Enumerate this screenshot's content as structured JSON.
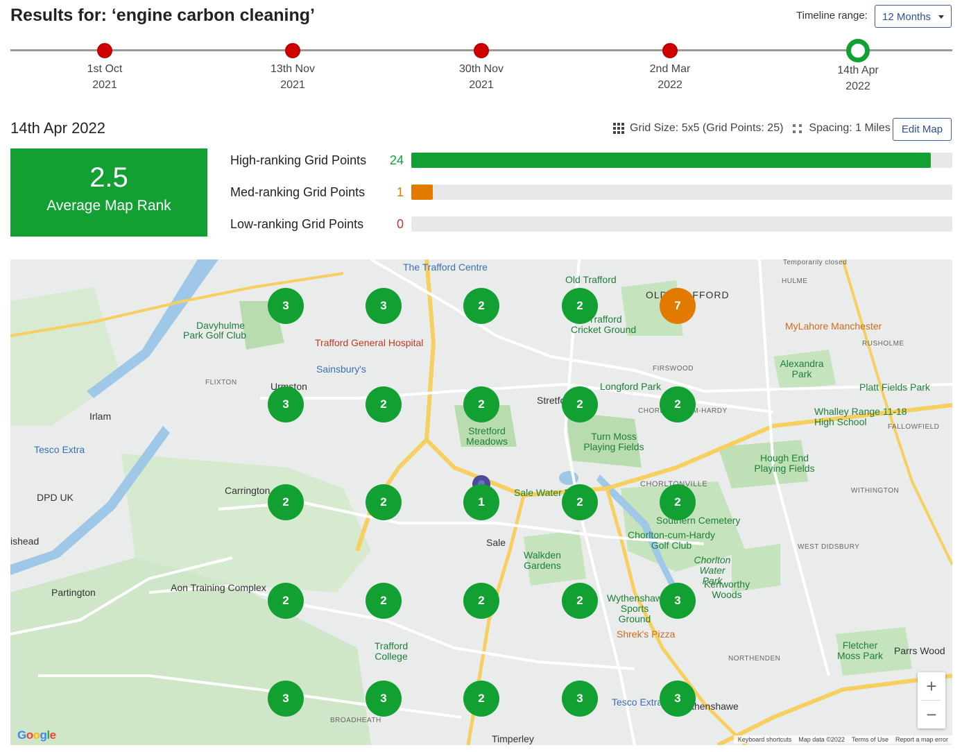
{
  "header": {
    "title": "Results for: ‘engine carbon cleaning’",
    "timeline_range_label": "Timeline range:",
    "timeline_range_value": "12 Months"
  },
  "timeline": [
    {
      "day": "1st Oct",
      "year": "2021",
      "active": false
    },
    {
      "day": "13th Nov",
      "year": "2021",
      "active": false
    },
    {
      "day": "30th Nov",
      "year": "2021",
      "active": false
    },
    {
      "day": "2nd Mar",
      "year": "2022",
      "active": false
    },
    {
      "day": "14th Apr",
      "year": "2022",
      "active": true
    }
  ],
  "summary": {
    "selected_date": "14th Apr 2022",
    "grid_size": "Grid Size: 5x5 (Grid Points: 25)",
    "spacing": "Spacing: 1 Miles",
    "edit_map": "Edit Map",
    "average_rank": "2.5",
    "average_rank_label": "Average Map Rank"
  },
  "ranking": [
    {
      "label": "High-ranking Grid Points",
      "count": "24",
      "fraction": 0.96,
      "color": "#12a032"
    },
    {
      "label": "Med-ranking Grid Points",
      "count": "1",
      "fraction": 0.04,
      "color": "#e37a00"
    },
    {
      "label": "Low-ranking Grid Points",
      "count": "0",
      "fraction": 0,
      "color": "#c0392b"
    }
  ],
  "map": {
    "grid_ranks": [
      [
        "3",
        "3",
        "2",
        "2",
        "7"
      ],
      [
        "3",
        "2",
        "2",
        "2",
        "2"
      ],
      [
        "2",
        "2",
        "1",
        "2",
        "2"
      ],
      [
        "2",
        "2",
        "2",
        "2",
        "3"
      ],
      [
        "3",
        "3",
        "2",
        "3",
        "3"
      ]
    ],
    "labels": {
      "trafford_centre": "The Trafford Centre",
      "old_trafford": "Old Trafford",
      "old_trafford_area": "OLD TRAFFORD",
      "davyhulme": "Davyhulme",
      "park_golf": "Park Golf Club",
      "trafford_hospital": "Trafford General Hospital",
      "sainsburys": "Sainsbury's",
      "cricket_ground": "Old Trafford Cricket Ground",
      "mylahore": "MyLahore Manchester",
      "alexandra_park": "Alexandra Park",
      "flixton": "FLIXTON",
      "urmston": "Urmston",
      "stretford": "Stretford",
      "longford_park": "Longford Park",
      "firswood": "FIRSWOOD",
      "platt_fields": "Platt Fields Park",
      "whalley_range": "Whalley Range 11-18 High School",
      "irlam": "Irlam",
      "tesco_extra": "Tesco Extra",
      "stretford_meadows": "Stretford Meadows",
      "turn_moss": "Turn Moss Playing Fields",
      "hough_end": "Hough End Playing Fields",
      "dpd_uk": "DPD UK",
      "carrington": "Carrington",
      "sale_water": "Sale Water Park",
      "chorltonville": "CHORLTONVILLE",
      "withington": "WITHINGTON",
      "southern_cemetery": "Southern Cemetery",
      "chorlton_golf": "Chorlton-cum-Hardy Golf Club",
      "irlams_head": "ishead",
      "sale": "Sale",
      "walkden_gardens": "Walkden Gardens",
      "chorlton_water_park": "Chorlton Water Park",
      "west_didsbury": "WEST DIDSBURY",
      "partington": "Partington",
      "aon_training": "Aon Training Complex",
      "kenworthy_woods": "Kenworthy Woods",
      "wythenshawe_sports": "Wythenshawe Sports Ground",
      "shreks_pizza": "Shrek's Pizza",
      "trafford_college": "Trafford College",
      "northenden": "NORTHENDEN",
      "fletcher_moss": "Fletcher Moss Park",
      "parrs_wood": "Parrs Wood",
      "tesco_extra2": "Tesco Extra",
      "wythenshawe": "Wythenshawe",
      "broadheath": "BROADHEATH",
      "timperley": "Timperley",
      "hulme": "HULME",
      "rusholme": "RUSHOLME",
      "fallowfield": "FALLOWFIELD",
      "chorlton": "CHORLTON-CUM-HARDY",
      "temporarily_closed": "Temporarily closed"
    },
    "attribution": {
      "shortcuts": "Keyboard shortcuts",
      "data": "Map data ©2022",
      "terms": "Terms of Use",
      "report": "Report a map error"
    },
    "zoom_in": "+",
    "zoom_out": "−",
    "logo": "Google"
  }
}
